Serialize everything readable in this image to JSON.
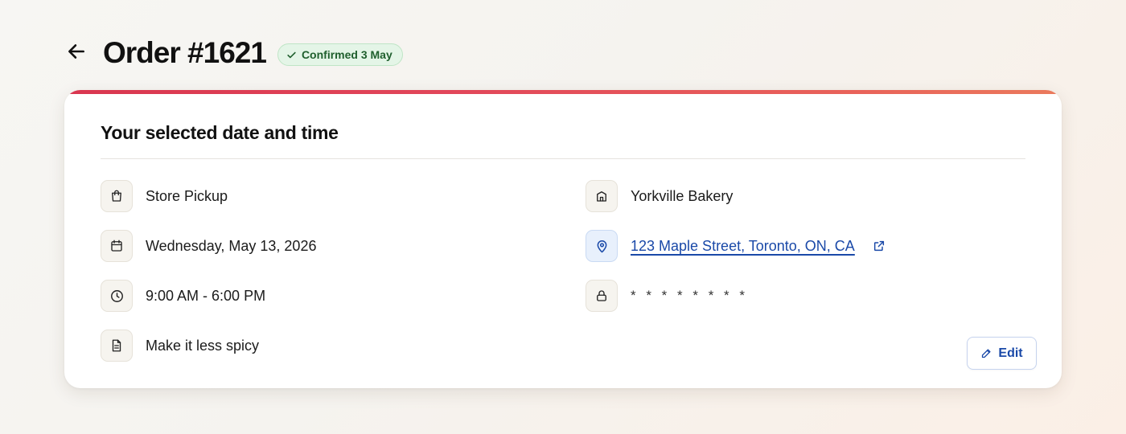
{
  "header": {
    "title": "Order #1621",
    "status_badge": "Confirmed 3 May"
  },
  "card": {
    "title": "Your selected date and time",
    "left_items": [
      {
        "icon": "shopping-bag-icon",
        "label": "Store Pickup"
      },
      {
        "icon": "calendar-icon",
        "label": "Wednesday, May 13, 2026"
      },
      {
        "icon": "clock-icon",
        "label": "9:00 AM - 6:00 PM"
      },
      {
        "icon": "document-icon",
        "label": "Make it less spicy"
      }
    ],
    "right_items": [
      {
        "icon": "store-icon",
        "label": "Yorkville Bakery"
      },
      {
        "icon": "map-pin-icon",
        "label": "123 Maple Street, Toronto, ON, CA"
      },
      {
        "icon": "lock-icon",
        "label": "* * * * * * * *"
      }
    ],
    "edit_label": "Edit"
  },
  "colors": {
    "accent_start": "#d9364f",
    "accent_end": "#ea7a5c",
    "link": "#1a49a8",
    "badge_bg": "#e4f5e7",
    "badge_text": "#1f5f2d"
  }
}
